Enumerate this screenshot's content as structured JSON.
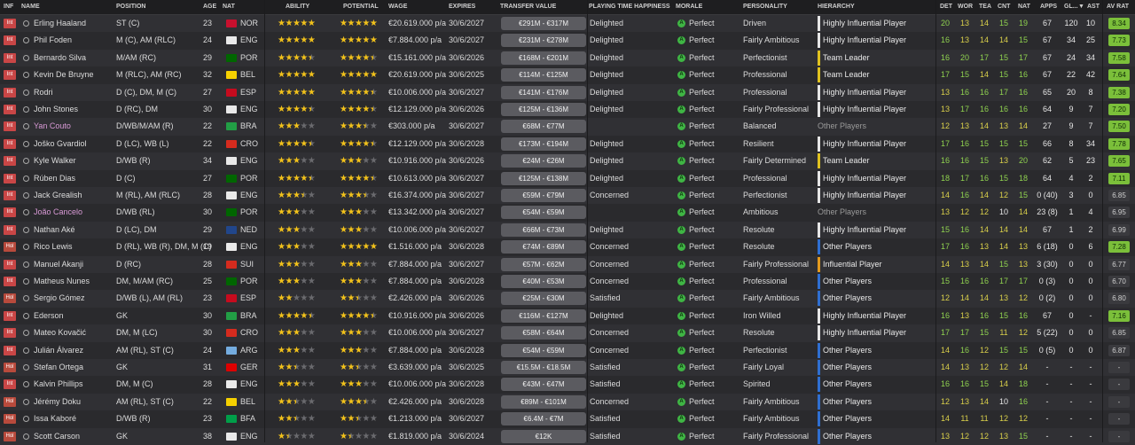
{
  "columns": {
    "inf": "INF",
    "name": "NAME",
    "position": "POSITION",
    "age": "AGE",
    "nat": "NAT",
    "ability": "ABILITY",
    "potential": "POTENTIAL",
    "wage": "WAGE",
    "expires": "EXPIRES",
    "transfer_value": "TRANSFER VALUE",
    "happiness": "PLAYING TIME HAPPINESS",
    "morale": "MORALE",
    "personality": "PERSONALITY",
    "hierarchy": "HIERARCHY",
    "det": "DET",
    "wor": "WOR",
    "tea": "TEA",
    "cnt": "CNT",
    "nat2": "NAT",
    "apps": "APPS",
    "gls": "GL...",
    "ast": "AST",
    "av_rat": "AV RAT"
  },
  "sort_indicator": "▼",
  "morale_icon_letter": "A",
  "colors": {
    "flag_NOR": "#c8102e",
    "flag_ENG": "#e9e9e9",
    "flag_BEL": "#f5d000",
    "flag_ESP": "#c60b1e",
    "flag_BRA": "#229e45",
    "flag_CRO": "#d52b1e",
    "flag_POR": "#006600",
    "flag_NED": "#21468b",
    "flag_SUI": "#d52b1e",
    "flag_ARG": "#74acdf",
    "flag_GER": "#dd0000",
    "flag_BFA": "#009e49",
    "hier_yellow": "#e0c21f",
    "hier_white": "#e6e6e6",
    "hier_blue": "#2f6fd1",
    "hier_orange": "#e39a1e"
  },
  "players": [
    {
      "inf": "Int",
      "name": "Erling Haaland",
      "pink": false,
      "pos": "ST (C)",
      "age": "23",
      "nat": "NOR",
      "ab": 5,
      "pot": 5,
      "wage": "€20.619.000 p/a",
      "exp": "30/6/2027",
      "tv": "€291M - €317M",
      "happy": "Delighted",
      "morale": "Perfect",
      "pers": "Driven",
      "hier": "Highly Influential Player",
      "hc": "hier_white",
      "det": "20",
      "wor": "13",
      "tea": "14",
      "cnt": "15",
      "nat2": "19",
      "apps": "67",
      "gls": "120",
      "ast": "10",
      "rat": "8.34",
      "rc": "good"
    },
    {
      "inf": "Int",
      "name": "Phil Foden",
      "pink": false,
      "pos": "M (C), AM (RLC)",
      "age": "24",
      "nat": "ENG",
      "ab": 5,
      "pot": 5,
      "wage": "€7.884.000 p/a",
      "exp": "30/6/2027",
      "tv": "€231M - €278M",
      "happy": "Delighted",
      "morale": "Perfect",
      "pers": "Fairly Ambitious",
      "hier": "Highly Influential Player",
      "hc": "hier_white",
      "det": "16",
      "wor": "13",
      "tea": "14",
      "cnt": "14",
      "nat2": "15",
      "apps": "67",
      "gls": "34",
      "ast": "25",
      "rat": "7.73",
      "rc": "good"
    },
    {
      "inf": "Int",
      "name": "Bernardo Silva",
      "pink": false,
      "pos": "M/AM (RC)",
      "age": "29",
      "nat": "POR",
      "ab": 4.5,
      "pot": 4.5,
      "wage": "€15.161.000 p/a",
      "exp": "30/6/2026",
      "tv": "€168M - €201M",
      "happy": "Delighted",
      "morale": "Perfect",
      "pers": "Perfectionist",
      "hier": "Team Leader",
      "hc": "hier_yellow",
      "det": "16",
      "wor": "20",
      "tea": "17",
      "cnt": "15",
      "nat2": "17",
      "apps": "67",
      "gls": "24",
      "ast": "34",
      "rat": "7.58",
      "rc": "good"
    },
    {
      "inf": "Int",
      "name": "Kevin De Bruyne",
      "pink": false,
      "pos": "M (RLC), AM (RC)",
      "age": "32",
      "nat": "BEL",
      "ab": 5,
      "pot": 5,
      "wage": "€20.619.000 p/a",
      "exp": "30/6/2025",
      "tv": "€114M - €125M",
      "happy": "Delighted",
      "morale": "Perfect",
      "pers": "Professional",
      "hier": "Team Leader",
      "hc": "hier_yellow",
      "det": "17",
      "wor": "15",
      "tea": "14",
      "cnt": "15",
      "nat2": "16",
      "apps": "67",
      "gls": "22",
      "ast": "42",
      "rat": "7.64",
      "rc": "good"
    },
    {
      "inf": "Int",
      "name": "Rodri",
      "pink": false,
      "pos": "D (C), DM, M (C)",
      "age": "27",
      "nat": "ESP",
      "ab": 5,
      "pot": 4.5,
      "wage": "€10.006.000 p/a",
      "exp": "30/6/2027",
      "tv": "€141M - €176M",
      "happy": "Delighted",
      "morale": "Perfect",
      "pers": "Professional",
      "hier": "Highly Influential Player",
      "hc": "hier_white",
      "det": "13",
      "wor": "16",
      "tea": "16",
      "cnt": "17",
      "nat2": "16",
      "apps": "65",
      "gls": "20",
      "ast": "8",
      "rat": "7.38",
      "rc": "good"
    },
    {
      "inf": "Int",
      "name": "John Stones",
      "pink": false,
      "pos": "D (RC), DM",
      "age": "30",
      "nat": "ENG",
      "ab": 4.5,
      "pot": 4.5,
      "wage": "€12.129.000 p/a",
      "exp": "30/6/2026",
      "tv": "€125M - €136M",
      "happy": "Delighted",
      "morale": "Perfect",
      "pers": "Fairly Professional",
      "hier": "Highly Influential Player",
      "hc": "hier_white",
      "det": "13",
      "wor": "17",
      "tea": "16",
      "cnt": "16",
      "nat2": "16",
      "apps": "64",
      "gls": "9",
      "ast": "7",
      "rat": "7.20",
      "rc": "good"
    },
    {
      "inf": "Int",
      "name": "Yan Couto",
      "pink": true,
      "pos": "D/WB/M/AM (R)",
      "age": "22",
      "nat": "BRA",
      "ab": 3,
      "pot": 3.5,
      "wage": "€303.000 p/a",
      "exp": "30/6/2027",
      "tv": "€68M - €77M",
      "happy": "",
      "morale": "Perfect",
      "pers": "Balanced",
      "hier": "Other Players",
      "hc": "",
      "det": "12",
      "wor": "13",
      "tea": "14",
      "cnt": "13",
      "nat2": "14",
      "apps": "27",
      "gls": "9",
      "ast": "7",
      "rat": "7.50",
      "rc": "good"
    },
    {
      "inf": "Int",
      "name": "Joško Gvardiol",
      "pink": false,
      "pos": "D (LC), WB (L)",
      "age": "22",
      "nat": "CRO",
      "ab": 4.5,
      "pot": 4.5,
      "wage": "€12.129.000 p/a",
      "exp": "30/6/2028",
      "tv": "€173M - €194M",
      "happy": "Delighted",
      "morale": "Perfect",
      "pers": "Resilient",
      "hier": "Highly Influential Player",
      "hc": "hier_white",
      "det": "17",
      "wor": "16",
      "tea": "15",
      "cnt": "15",
      "nat2": "15",
      "apps": "66",
      "gls": "8",
      "ast": "34",
      "rat": "7.78",
      "rc": "good"
    },
    {
      "inf": "Int",
      "name": "Kyle Walker",
      "pink": false,
      "pos": "D/WB (R)",
      "age": "34",
      "nat": "ENG",
      "ab": 3,
      "pot": 3,
      "wage": "€10.916.000 p/a",
      "exp": "30/6/2026",
      "tv": "€24M - €26M",
      "happy": "Delighted",
      "morale": "Perfect",
      "pers": "Fairly Determined",
      "hier": "Team Leader",
      "hc": "hier_yellow",
      "det": "16",
      "wor": "16",
      "tea": "15",
      "cnt": "13",
      "nat2": "20",
      "apps": "62",
      "gls": "5",
      "ast": "23",
      "rat": "7.65",
      "rc": "good"
    },
    {
      "inf": "Int",
      "name": "Rúben Dias",
      "pink": false,
      "pos": "D (C)",
      "age": "27",
      "nat": "POR",
      "ab": 4.5,
      "pot": 4.5,
      "wage": "€10.613.000 p/a",
      "exp": "30/6/2027",
      "tv": "€125M - €138M",
      "happy": "Delighted",
      "morale": "Perfect",
      "pers": "Professional",
      "hier": "Highly Influential Player",
      "hc": "hier_white",
      "det": "18",
      "wor": "17",
      "tea": "16",
      "cnt": "15",
      "nat2": "18",
      "apps": "64",
      "gls": "4",
      "ast": "2",
      "rat": "7.11",
      "rc": "good"
    },
    {
      "inf": "Int",
      "name": "Jack Grealish",
      "pink": false,
      "pos": "M (RL), AM (RLC)",
      "age": "28",
      "nat": "ENG",
      "ab": 3.5,
      "pot": 3.5,
      "wage": "€16.374.000 p/a",
      "exp": "30/6/2027",
      "tv": "€59M - €79M",
      "happy": "Concerned",
      "morale": "Perfect",
      "pers": "Perfectionist",
      "hier": "Highly Influential Player",
      "hc": "hier_white",
      "det": "14",
      "wor": "16",
      "tea": "14",
      "cnt": "12",
      "nat2": "15",
      "apps": "0 (40)",
      "gls": "3",
      "ast": "0",
      "rat": "6.85",
      "rc": "dark"
    },
    {
      "inf": "Int",
      "name": "João Cancelo",
      "pink": true,
      "pos": "D/WB (RL)",
      "age": "30",
      "nat": "POR",
      "ab": 3,
      "pot": 3,
      "wage": "€13.342.000 p/a",
      "exp": "30/6/2027",
      "tv": "€54M - €59M",
      "happy": "",
      "morale": "Perfect",
      "pers": "Ambitious",
      "hier": "Other Players",
      "hc": "",
      "det": "13",
      "wor": "12",
      "tea": "12",
      "cnt": "10",
      "nat2": "14",
      "apps": "23 (8)",
      "gls": "1",
      "ast": "4",
      "rat": "6.95",
      "rc": "dark"
    },
    {
      "inf": "Int",
      "name": "Nathan Aké",
      "pink": false,
      "pos": "D (LC), DM",
      "age": "29",
      "nat": "NED",
      "ab": 3,
      "pot": 3,
      "wage": "€10.006.000 p/a",
      "exp": "30/6/2027",
      "tv": "€66M - €73M",
      "happy": "Delighted",
      "morale": "Perfect",
      "pers": "Resolute",
      "hier": "Highly Influential Player",
      "hc": "hier_white",
      "det": "15",
      "wor": "16",
      "tea": "14",
      "cnt": "14",
      "nat2": "14",
      "apps": "67",
      "gls": "1",
      "ast": "2",
      "rat": "6.99",
      "rc": "dark"
    },
    {
      "inf": "Hol",
      "name": "Rico Lewis",
      "pink": false,
      "pos": "D (RL), WB (R), DM, M (C)",
      "age": "19",
      "nat": "ENG",
      "ab": 3,
      "pot": 5,
      "wage": "€1.516.000 p/a",
      "exp": "30/6/2028",
      "tv": "€74M - €89M",
      "happy": "Concerned",
      "morale": "Perfect",
      "pers": "Resolute",
      "hier": "Other Players",
      "hc": "hier_blue",
      "det": "17",
      "wor": "16",
      "tea": "13",
      "cnt": "14",
      "nat2": "13",
      "apps": "6 (18)",
      "gls": "0",
      "ast": "6",
      "rat": "7.28",
      "rc": "good"
    },
    {
      "inf": "Int",
      "name": "Manuel Akanji",
      "pink": false,
      "pos": "D (RC)",
      "age": "28",
      "nat": "SUI",
      "ab": 3,
      "pot": 3,
      "wage": "€7.884.000 p/a",
      "exp": "30/6/2027",
      "tv": "€57M - €62M",
      "happy": "Concerned",
      "morale": "Perfect",
      "pers": "Fairly Professional",
      "hier": "Influential Player",
      "hc": "hier_orange",
      "det": "14",
      "wor": "13",
      "tea": "14",
      "cnt": "15",
      "nat2": "13",
      "apps": "3 (30)",
      "gls": "0",
      "ast": "0",
      "rat": "6.77",
      "rc": "dark"
    },
    {
      "inf": "Int",
      "name": "Matheus Nunes",
      "pink": false,
      "pos": "DM, M/AM (RC)",
      "age": "25",
      "nat": "POR",
      "ab": 3,
      "pot": 3,
      "wage": "€7.884.000 p/a",
      "exp": "30/6/2028",
      "tv": "€40M - €53M",
      "happy": "Concerned",
      "morale": "Perfect",
      "pers": "Professional",
      "hier": "Other Players",
      "hc": "hier_blue",
      "det": "15",
      "wor": "16",
      "tea": "16",
      "cnt": "17",
      "nat2": "17",
      "apps": "0 (3)",
      "gls": "0",
      "ast": "0",
      "rat": "6.70",
      "rc": "dark"
    },
    {
      "inf": "Hol",
      "name": "Sergio Gómez",
      "pink": false,
      "pos": "D/WB (L), AM (RL)",
      "age": "23",
      "nat": "ESP",
      "ab": 2,
      "pot": 2.5,
      "wage": "€2.426.000 p/a",
      "exp": "30/6/2026",
      "tv": "€25M - €30M",
      "happy": "Satisfied",
      "morale": "Perfect",
      "pers": "Fairly Ambitious",
      "hier": "Other Players",
      "hc": "hier_blue",
      "det": "12",
      "wor": "14",
      "tea": "14",
      "cnt": "13",
      "nat2": "12",
      "apps": "0 (2)",
      "gls": "0",
      "ast": "0",
      "rat": "6.80",
      "rc": "dark"
    },
    {
      "inf": "Int",
      "name": "Ederson",
      "pink": false,
      "pos": "GK",
      "age": "30",
      "nat": "BRA",
      "ab": 4.5,
      "pot": 4.5,
      "wage": "€10.916.000 p/a",
      "exp": "30/6/2026",
      "tv": "€116M - €127M",
      "happy": "Delighted",
      "morale": "Perfect",
      "pers": "Iron Willed",
      "hier": "Highly Influential Player",
      "hc": "hier_white",
      "det": "16",
      "wor": "13",
      "tea": "16",
      "cnt": "15",
      "nat2": "16",
      "apps": "67",
      "gls": "0",
      "ast": "-",
      "rat": "7.16",
      "rc": "good"
    },
    {
      "inf": "Int",
      "name": "Mateo Kovačić",
      "pink": false,
      "pos": "DM, M (LC)",
      "age": "30",
      "nat": "CRO",
      "ab": 3,
      "pot": 3,
      "wage": "€10.006.000 p/a",
      "exp": "30/6/2027",
      "tv": "€58M - €64M",
      "happy": "Concerned",
      "morale": "Perfect",
      "pers": "Resolute",
      "hier": "Highly Influential Player",
      "hc": "hier_white",
      "det": "17",
      "wor": "17",
      "tea": "15",
      "cnt": "11",
      "nat2": "12",
      "apps": "5 (22)",
      "gls": "0",
      "ast": "0",
      "rat": "6.85",
      "rc": "dark"
    },
    {
      "inf": "Int",
      "name": "Julián Álvarez",
      "pink": false,
      "pos": "AM (RL), ST (C)",
      "age": "24",
      "nat": "ARG",
      "ab": 3,
      "pot": 3,
      "wage": "€7.884.000 p/a",
      "exp": "30/6/2028",
      "tv": "€54M - €59M",
      "happy": "Concerned",
      "morale": "Perfect",
      "pers": "Perfectionist",
      "hier": "Other Players",
      "hc": "hier_blue",
      "det": "14",
      "wor": "16",
      "tea": "12",
      "cnt": "15",
      "nat2": "15",
      "apps": "0 (5)",
      "gls": "0",
      "ast": "0",
      "rat": "6.87",
      "rc": "dark"
    },
    {
      "inf": "Hol",
      "name": "Stefan Ortega",
      "pink": false,
      "pos": "GK",
      "age": "31",
      "nat": "GER",
      "ab": 2.5,
      "pot": 2.5,
      "wage": "€3.639.000 p/a",
      "exp": "30/6/2025",
      "tv": "€15.5M - €18.5M",
      "happy": "Satisfied",
      "morale": "Perfect",
      "pers": "Fairly Loyal",
      "hier": "Other Players",
      "hc": "hier_blue",
      "det": "14",
      "wor": "13",
      "tea": "12",
      "cnt": "12",
      "nat2": "14",
      "apps": "-",
      "gls": "-",
      "ast": "-",
      "rat": "-",
      "rc": "dark"
    },
    {
      "inf": "Int",
      "name": "Kalvin Phillips",
      "pink": false,
      "pos": "DM, M (C)",
      "age": "28",
      "nat": "ENG",
      "ab": 3,
      "pot": 3,
      "wage": "€10.006.000 p/a",
      "exp": "30/6/2028",
      "tv": "€43M - €47M",
      "happy": "Satisfied",
      "morale": "Perfect",
      "pers": "Spirited",
      "hier": "Other Players",
      "hc": "hier_blue",
      "det": "16",
      "wor": "16",
      "tea": "15",
      "cnt": "14",
      "nat2": "18",
      "apps": "-",
      "gls": "-",
      "ast": "-",
      "rat": "-",
      "rc": "dark"
    },
    {
      "inf": "Hol",
      "name": "Jérémy Doku",
      "pink": false,
      "pos": "AM (RL), ST (C)",
      "age": "22",
      "nat": "BEL",
      "ab": 2.5,
      "pot": 3.5,
      "wage": "€2.426.000 p/a",
      "exp": "30/6/2028",
      "tv": "€89M - €101M",
      "happy": "Concerned",
      "morale": "Perfect",
      "pers": "Fairly Ambitious",
      "hier": "Other Players",
      "hc": "hier_blue",
      "det": "12",
      "wor": "13",
      "tea": "14",
      "cnt": "10",
      "nat2": "16",
      "apps": "-",
      "gls": "-",
      "ast": "-",
      "rat": "-",
      "rc": "dark"
    },
    {
      "inf": "Hol",
      "name": "Issa Kaboré",
      "pink": false,
      "pos": "D/WB (R)",
      "age": "23",
      "nat": "BFA",
      "ab": 2.5,
      "pot": 2.5,
      "wage": "€1.213.000 p/a",
      "exp": "30/6/2027",
      "tv": "€6.4M - €7M",
      "happy": "Satisfied",
      "morale": "Perfect",
      "pers": "Fairly Ambitious",
      "hier": "Other Players",
      "hc": "hier_blue",
      "det": "14",
      "wor": "11",
      "tea": "11",
      "cnt": "12",
      "nat2": "12",
      "apps": "-",
      "gls": "-",
      "ast": "-",
      "rat": "-",
      "rc": "dark"
    },
    {
      "inf": "Hol",
      "name": "Scott Carson",
      "pink": false,
      "pos": "GK",
      "age": "38",
      "nat": "ENG",
      "ab": 1.5,
      "pot": 1.5,
      "wage": "€1.819.000 p/a",
      "exp": "30/6/2024",
      "tv": "€12K",
      "happy": "Satisfied",
      "morale": "Perfect",
      "pers": "Fairly Professional",
      "hier": "Other Players",
      "hc": "hier_blue",
      "det": "13",
      "wor": "12",
      "tea": "12",
      "cnt": "13",
      "nat2": "15",
      "apps": "-",
      "gls": "-",
      "ast": "-",
      "rat": "-",
      "rc": "dark"
    }
  ]
}
